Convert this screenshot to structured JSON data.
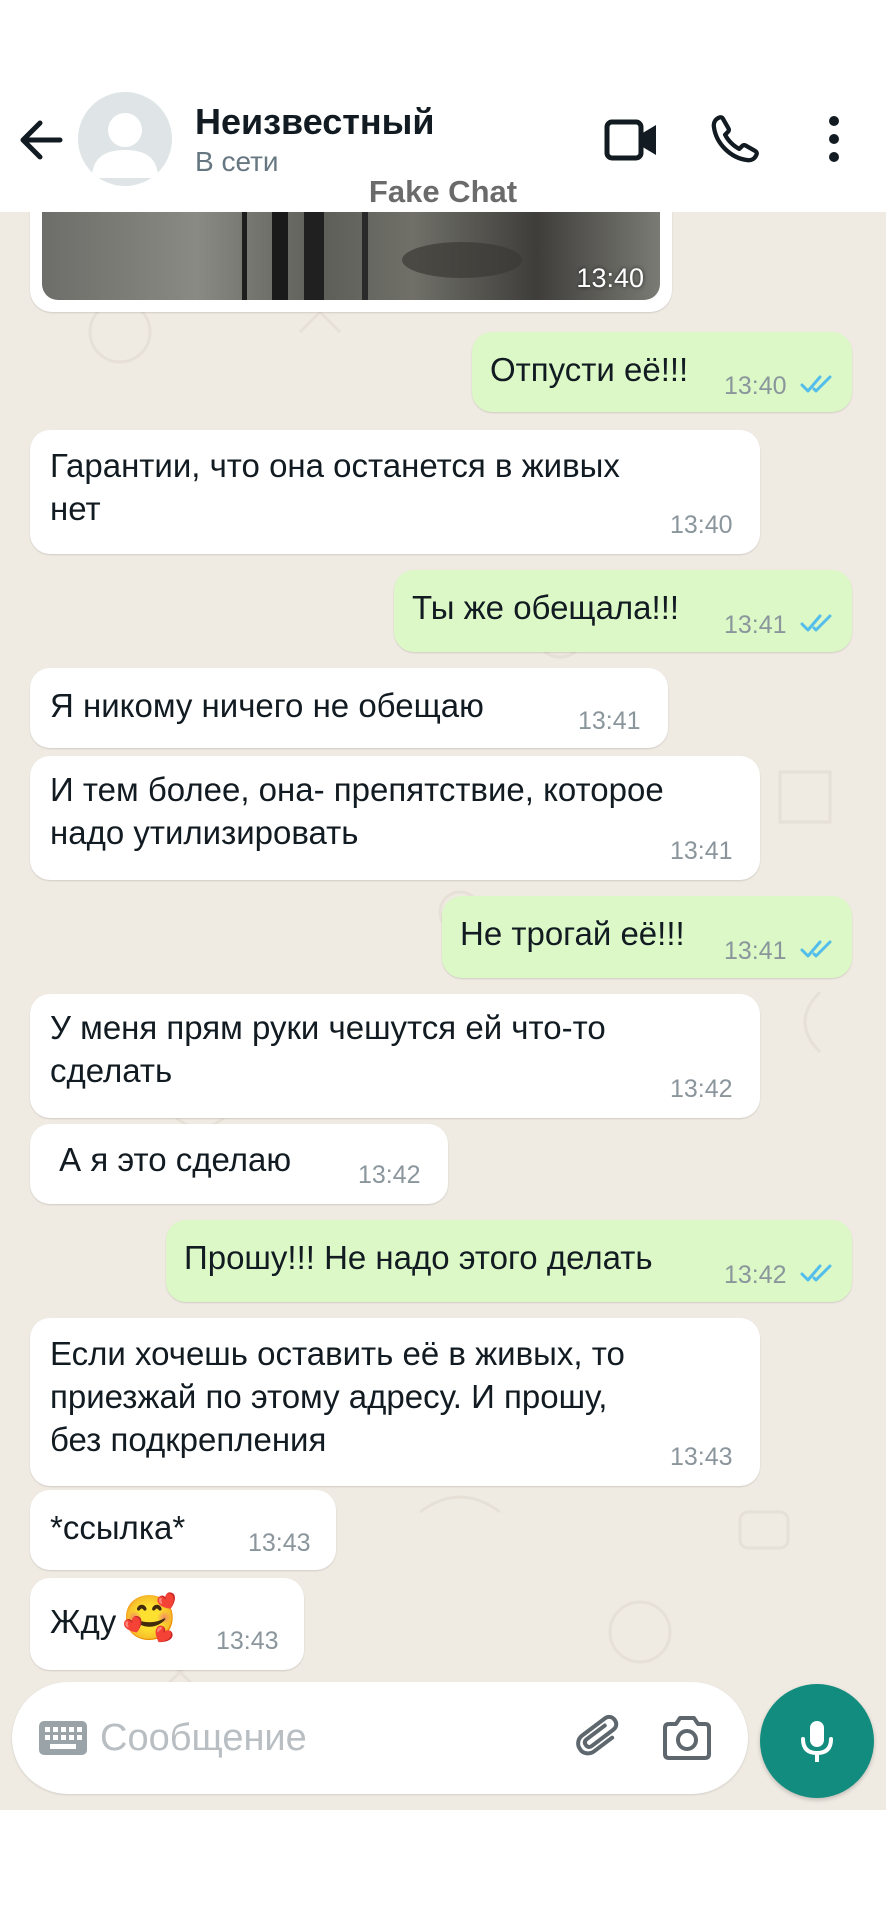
{
  "header": {
    "contact_name": "Неизвестный",
    "contact_status": "В сети",
    "watermark": "Fake Chat",
    "icons": [
      "back-arrow-icon",
      "avatar-placeholder-icon",
      "video-call-icon",
      "phone-icon",
      "more-vert-icon"
    ]
  },
  "image_message": {
    "time": "13:40"
  },
  "messages": [
    {
      "dir": "out",
      "text": "Отпусти её!!!",
      "time": "13:40",
      "read": true
    },
    {
      "dir": "in",
      "text": "Гарантии, что она останется в живых\nнет",
      "time": "13:40"
    },
    {
      "dir": "out",
      "text": "Ты же обещала!!!",
      "time": "13:41",
      "read": true
    },
    {
      "dir": "in",
      "text": "Я никому ничего не обещаю",
      "time": "13:41"
    },
    {
      "dir": "in",
      "text": "И тем более, она- препятствие, которое\nнадо утилизировать",
      "time": "13:41"
    },
    {
      "dir": "out",
      "text": "Не трогай её!!!",
      "time": "13:41",
      "read": true
    },
    {
      "dir": "in",
      "text": "У меня прям руки чешутся ей что-то\nсделать",
      "time": "13:42"
    },
    {
      "dir": "in",
      "text": " А я это сделаю",
      "time": "13:42"
    },
    {
      "dir": "out",
      "text": "Прошу!!! Не надо этого делать",
      "time": "13:42",
      "read": true
    },
    {
      "dir": "in",
      "text": "Если хочешь оставить её в живых, то\nприезжай по этому адресу. И прошу,\nбез подкрепления",
      "time": "13:43"
    },
    {
      "dir": "in",
      "text": "*ссылка*",
      "time": "13:43"
    },
    {
      "dir": "in",
      "text": "Жду",
      "emoji": "🥰",
      "time": "13:43"
    }
  ],
  "input": {
    "placeholder": "Сообщение"
  },
  "colors": {
    "chat_background": "#efeae2",
    "incoming_bubble": "#ffffff",
    "outgoing_bubble": "#dcf8c6",
    "read_ticks": "#53bdeb",
    "mic_button": "#128c7e"
  }
}
